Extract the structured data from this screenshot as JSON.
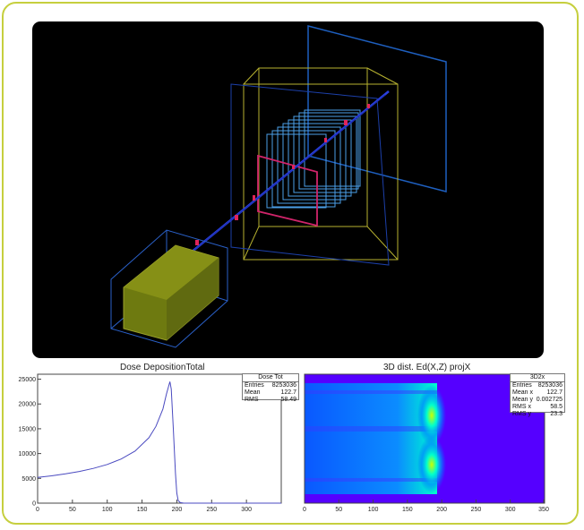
{
  "plots": {
    "dose": {
      "title": "Dose DepositionTotal",
      "stats": {
        "name": "Dose Tot",
        "rows": [
          {
            "label": "Entries",
            "value": "8253036"
          },
          {
            "label": "Mean",
            "value": "122.7"
          },
          {
            "label": "RMS",
            "value": "58.49"
          }
        ]
      },
      "y_ticks": [
        "25000",
        "20000",
        "15000",
        "10000",
        "5000",
        "0"
      ],
      "x_ticks": [
        "0",
        "50",
        "100",
        "150",
        "200",
        "250",
        "300"
      ]
    },
    "projx": {
      "title": "3D dist. Ed(X,Z) projX",
      "stats": {
        "name": "3D2x",
        "rows": [
          {
            "label": "Entries",
            "value": "8253036"
          },
          {
            "label": "Mean x",
            "value": "122.7"
          },
          {
            "label": "Mean y",
            "value": "0.002725"
          },
          {
            "label": "RMS x",
            "value": "58.5"
          },
          {
            "label": "RMS y",
            "value": "23.3"
          }
        ]
      },
      "x_ticks": [
        "0",
        "50",
        "100",
        "150",
        "200",
        "250",
        "300",
        "350"
      ]
    }
  },
  "chart_data": [
    {
      "type": "line",
      "title": "Dose DepositionTotal",
      "x": [
        0,
        20,
        40,
        60,
        80,
        100,
        120,
        140,
        160,
        170,
        180,
        185,
        190,
        192,
        195,
        198,
        200,
        202,
        205,
        210,
        350
      ],
      "y": [
        5200,
        5500,
        5900,
        6400,
        7000,
        7800,
        8900,
        10500,
        13200,
        15500,
        19000,
        22000,
        24500,
        23000,
        15000,
        6000,
        2000,
        500,
        100,
        0,
        0
      ],
      "ylim": [
        0,
        26000
      ],
      "xlim": [
        0,
        350
      ]
    },
    {
      "type": "heatmap",
      "title": "3D dist. Ed(X,Z) projX",
      "xlim": [
        0,
        350
      ],
      "colors": [
        "#5a00ff",
        "#0066ff",
        "#00ffcc",
        "#ccff00"
      ]
    }
  ]
}
